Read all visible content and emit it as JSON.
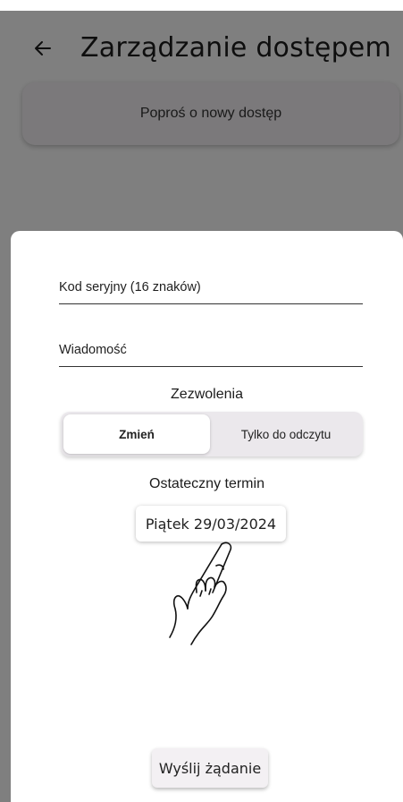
{
  "app_bar": {
    "title": "Zarządzanie dostępem",
    "back_icon": "arrow-left-icon"
  },
  "request_card": {
    "label": "Poproś o nowy dostęp"
  },
  "sheet": {
    "serial_field": {
      "label": "Kod seryjny (16 znaków)",
      "value": ""
    },
    "message_field": {
      "label": "Wiadomość",
      "value": ""
    },
    "permissions": {
      "label": "Zezwolenia",
      "options": [
        "Zmień",
        "Tylko do odczytu"
      ],
      "selected": "Zmień"
    },
    "deadline": {
      "label": "Ostateczny termin",
      "value": "Piątek 29/03/2024"
    },
    "tap_hint_icon": "hand-pointer-icon",
    "send_button": "Wyślij żądanie"
  },
  "colors": {
    "scrim": "#000000",
    "sheet_bg": "#ffffff",
    "segment_bg": "#ebe8ec"
  }
}
